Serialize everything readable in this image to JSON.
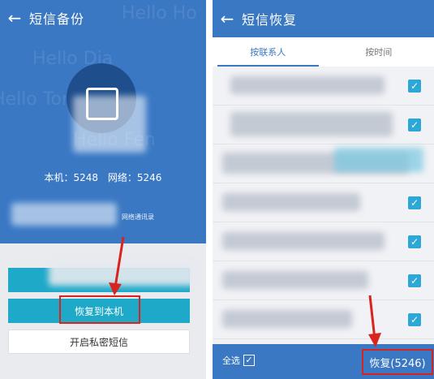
{
  "left": {
    "title": "短信备份",
    "counts": {
      "local": "本机：5248",
      "network": "网络：5246"
    },
    "note": "网络通讯录",
    "buttons": {
      "restore_local": "恢复到本机",
      "private_sms": "开启私密短信"
    }
  },
  "right": {
    "title": "短信恢复",
    "tabs": [
      {
        "label": "按联系人"
      },
      {
        "label": "按时间"
      }
    ],
    "row_count": 7,
    "bottom": {
      "select_all": "全选",
      "restore_button": "恢复(5246)"
    }
  },
  "colors": {
    "primary": "#3a78c4",
    "button": "#1ea9c9",
    "highlight": "#d8231f"
  }
}
